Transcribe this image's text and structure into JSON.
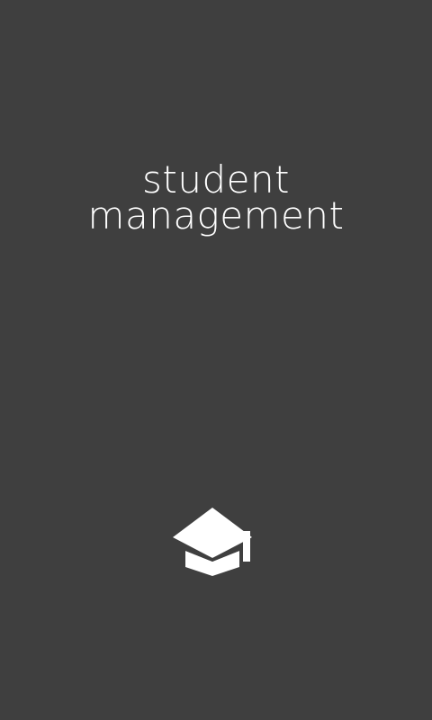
{
  "splash": {
    "title_line1": "student",
    "title_line2": "management",
    "logo_icon": "graduation-cap-icon",
    "background_color": "#3f3f3f",
    "foreground_color": "#ffffff"
  }
}
